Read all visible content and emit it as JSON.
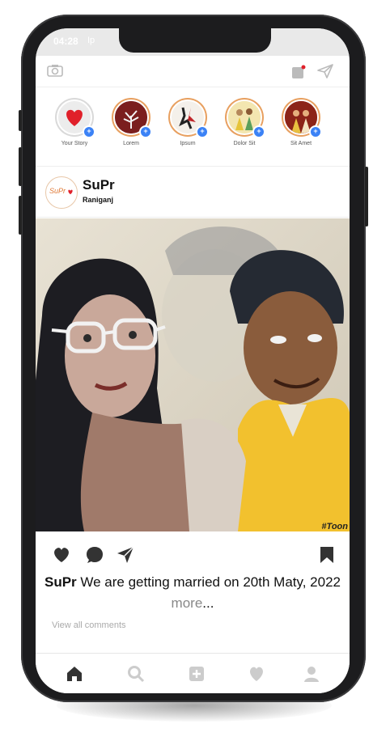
{
  "status_bar": {
    "time": "04:28",
    "carrier": "Ip"
  },
  "top_bar": {
    "camera_icon": "camera-icon",
    "activity_icon": "activity-icon",
    "send_icon": "paper-plane-icon"
  },
  "stories": [
    {
      "label": "Your Story",
      "own": true
    },
    {
      "label": "Lorem",
      "own": false
    },
    {
      "label": "Ipsum",
      "own": false
    },
    {
      "label": "Dolor Sit",
      "own": false
    },
    {
      "label": "Sit Amet",
      "own": false
    }
  ],
  "post": {
    "username": "SuPr",
    "location": "Raniganj",
    "avatar_text": "SuPr",
    "watermark": "#Toon",
    "caption_user": "SuPr",
    "caption_text": " We are getting married on 20th Maty, 2022 ",
    "caption_more": "more",
    "caption_ellipsis": "...",
    "view_comments": "View all comments"
  },
  "colors": {
    "story_ring": "#e8a060",
    "badge": "#3b82f6",
    "heart": "#e0202a",
    "phone_frame": "#1c1c1e"
  }
}
